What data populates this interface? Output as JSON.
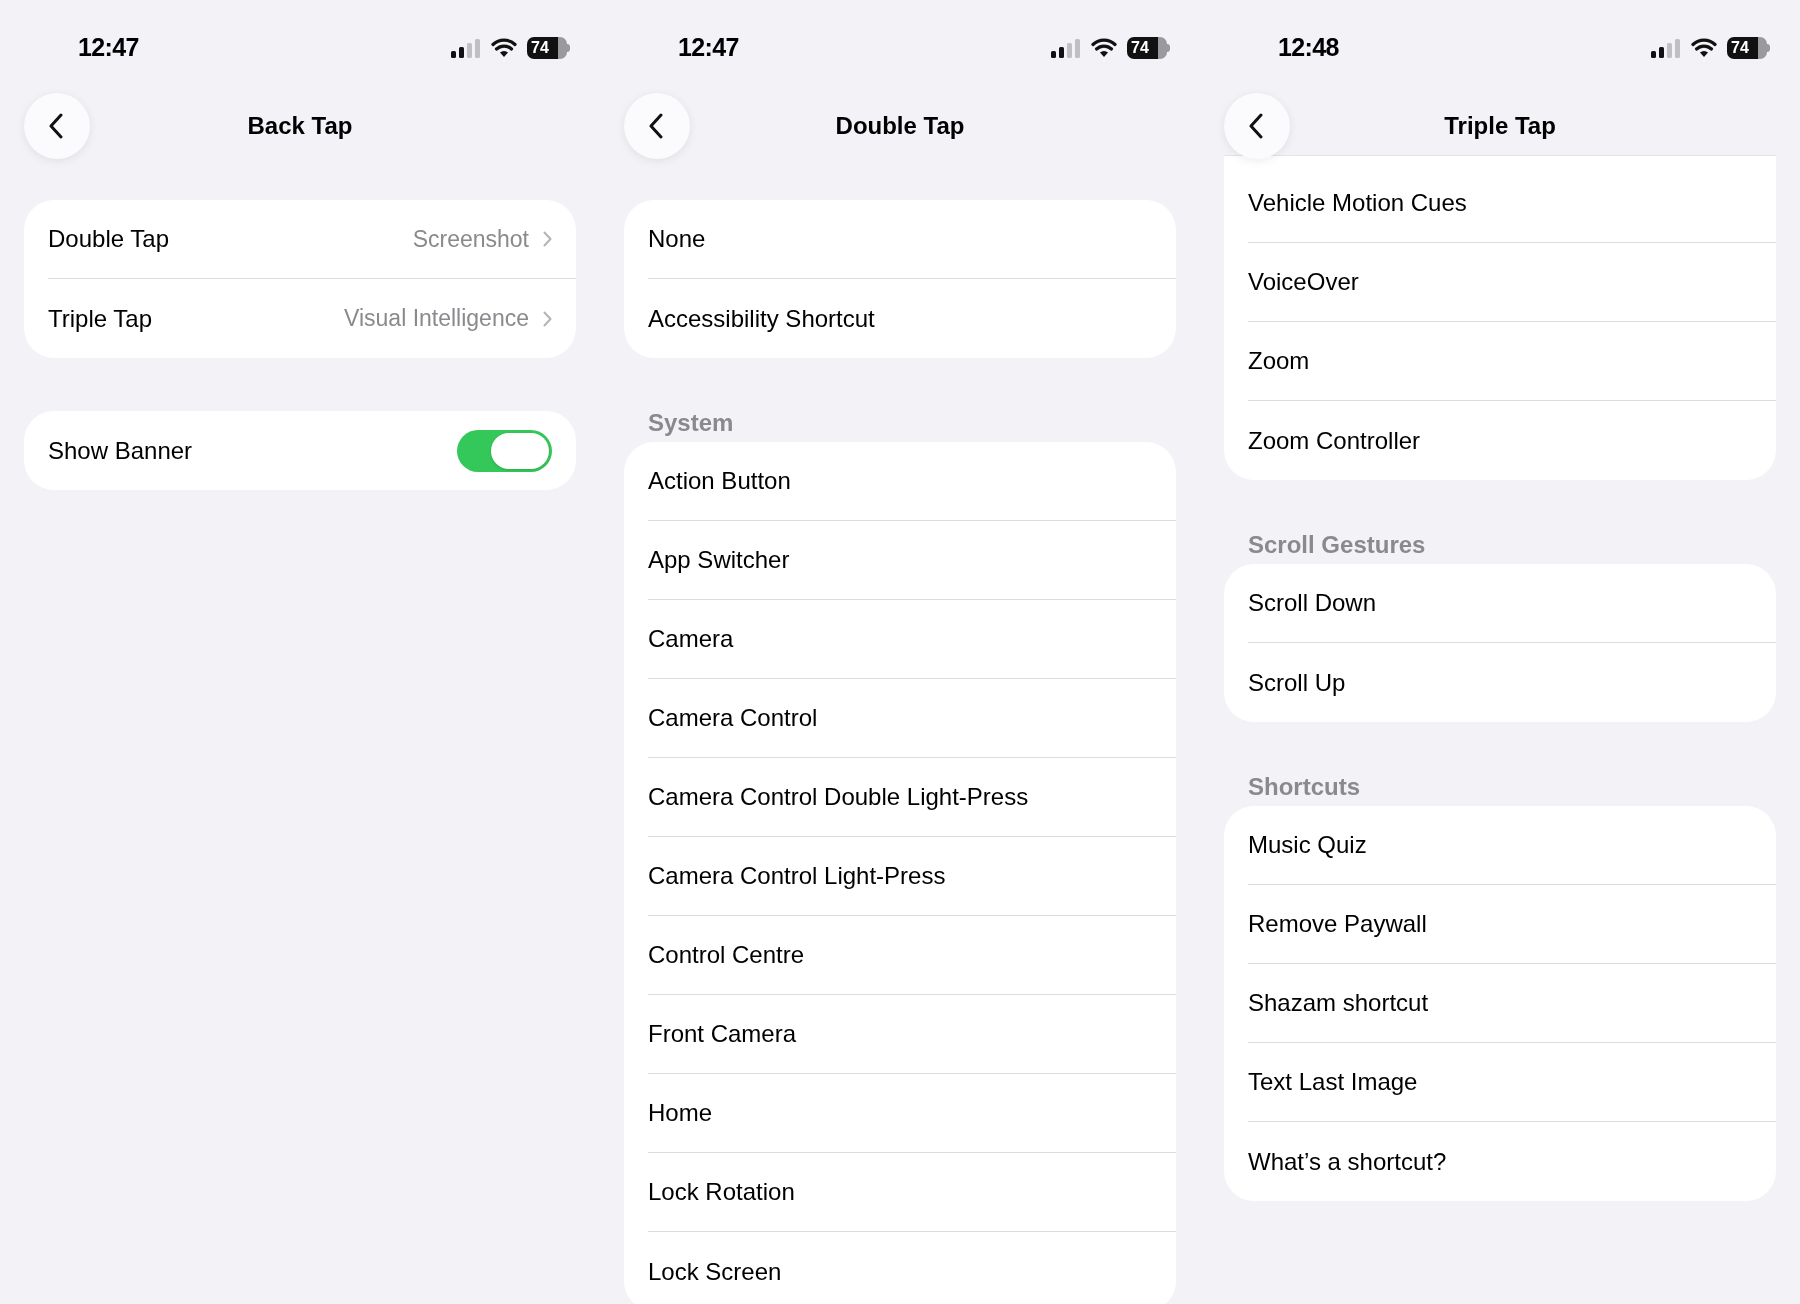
{
  "screens": [
    {
      "status_bar": {
        "time": "12:47",
        "battery": "74"
      },
      "title": "Back Tap",
      "scrolled": false,
      "sections": [
        {
          "rows": [
            {
              "kind": "link",
              "label": "Double Tap",
              "value": "Screenshot"
            },
            {
              "kind": "link",
              "label": "Triple Tap",
              "value": "Visual Intelligence"
            }
          ]
        },
        {
          "rows": [
            {
              "kind": "toggle",
              "label": "Show Banner",
              "on": true
            }
          ]
        }
      ]
    },
    {
      "status_bar": {
        "time": "12:47",
        "battery": "74"
      },
      "title": "Double Tap",
      "scrolled": false,
      "sections": [
        {
          "rows": [
            {
              "kind": "option",
              "label": "None"
            },
            {
              "kind": "option",
              "label": "Accessibility Shortcut"
            }
          ]
        },
        {
          "header": "System",
          "rows": [
            {
              "kind": "option",
              "label": "Action Button"
            },
            {
              "kind": "option",
              "label": "App Switcher"
            },
            {
              "kind": "option",
              "label": "Camera"
            },
            {
              "kind": "option",
              "label": "Camera Control"
            },
            {
              "kind": "option",
              "label": "Camera Control Double Light-Press"
            },
            {
              "kind": "option",
              "label": "Camera Control Light-Press"
            },
            {
              "kind": "option",
              "label": "Control Centre"
            },
            {
              "kind": "option",
              "label": "Front Camera"
            },
            {
              "kind": "option",
              "label": "Home"
            },
            {
              "kind": "option",
              "label": "Lock Rotation"
            },
            {
              "kind": "option",
              "label": "Lock Screen"
            }
          ]
        }
      ]
    },
    {
      "status_bar": {
        "time": "12:48",
        "battery": "74"
      },
      "title": "Triple Tap",
      "scrolled": true,
      "sections": [
        {
          "rows": [
            {
              "kind": "option",
              "label": "Vehicle Motion Cues"
            },
            {
              "kind": "option",
              "label": "VoiceOver"
            },
            {
              "kind": "option",
              "label": "Zoom"
            },
            {
              "kind": "option",
              "label": "Zoom Controller"
            }
          ]
        },
        {
          "header": "Scroll Gestures",
          "rows": [
            {
              "kind": "option",
              "label": "Scroll Down"
            },
            {
              "kind": "option",
              "label": "Scroll Up"
            }
          ]
        },
        {
          "header": "Shortcuts",
          "rows": [
            {
              "kind": "option",
              "label": "Music Quiz"
            },
            {
              "kind": "option",
              "label": "Remove Paywall"
            },
            {
              "kind": "option",
              "label": "Shazam shortcut"
            },
            {
              "kind": "option",
              "label": "Text Last Image"
            },
            {
              "kind": "option",
              "label": "What’s a shortcut?"
            }
          ]
        }
      ]
    }
  ]
}
